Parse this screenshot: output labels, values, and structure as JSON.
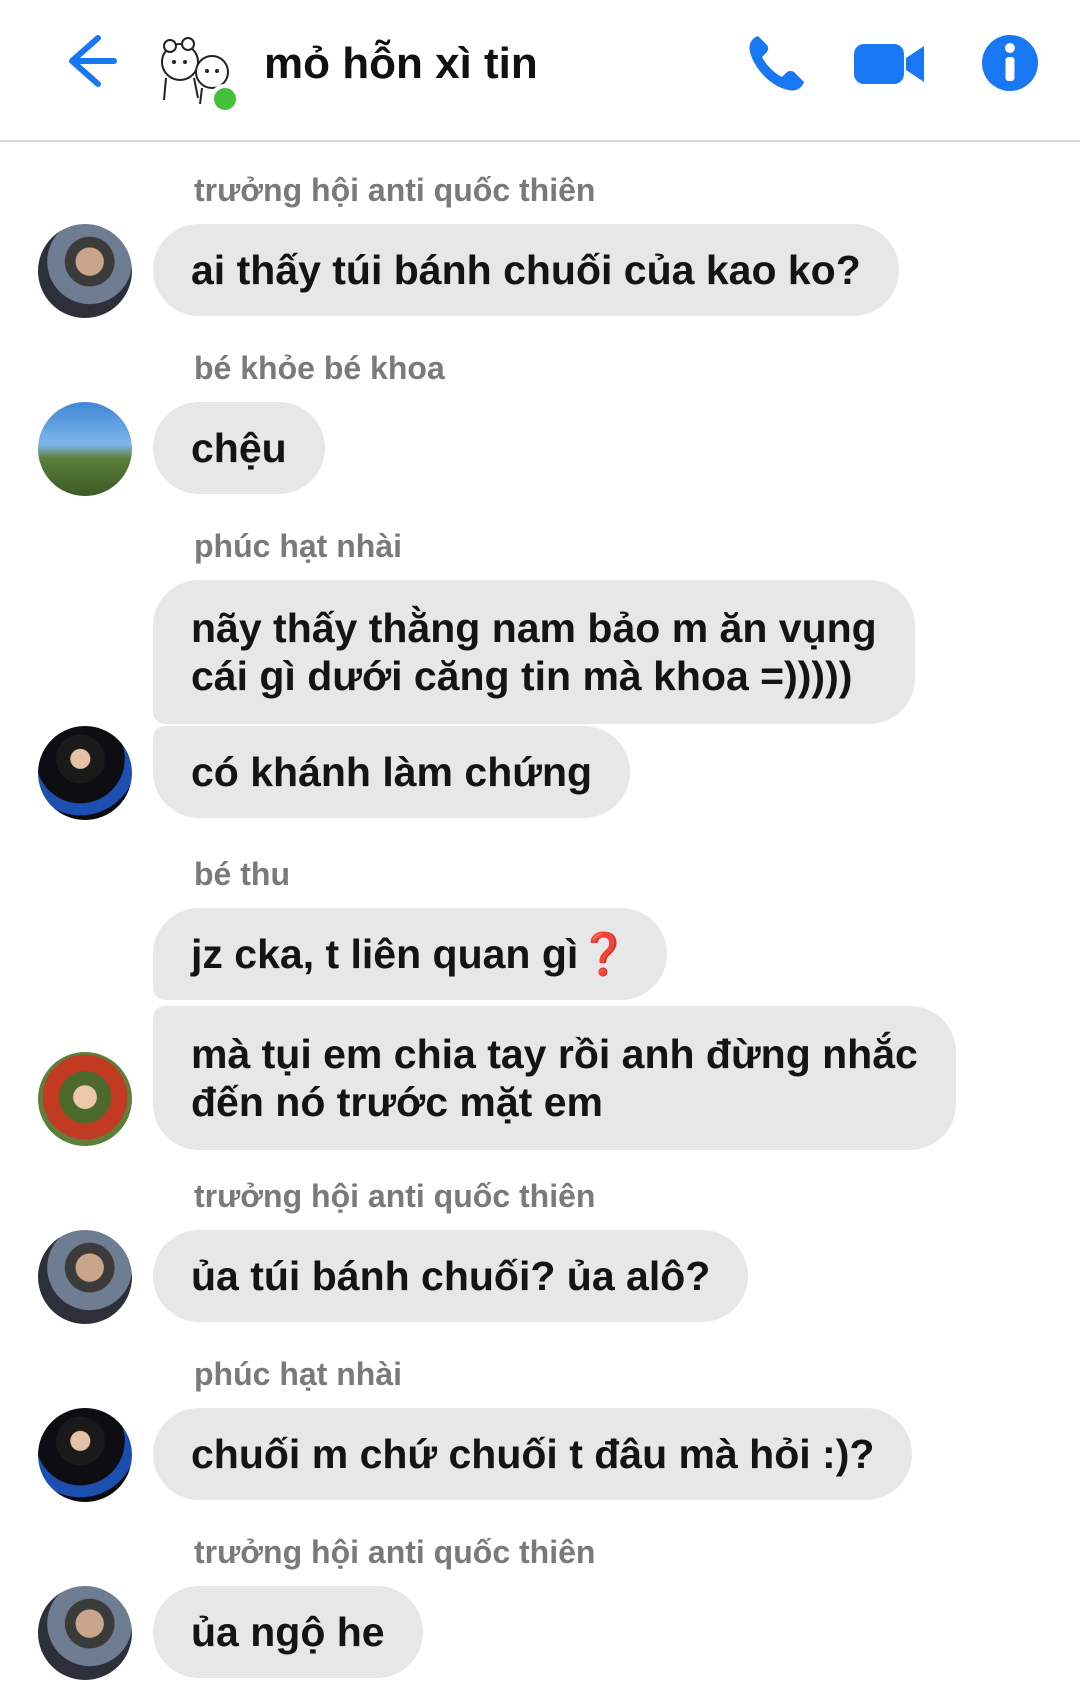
{
  "header": {
    "title": "mỏ hỗn xì tin",
    "accent_color": "#1877f2",
    "online_color": "#44c03b",
    "icons": [
      "back-arrow-icon",
      "group-avatar-icon",
      "phone-icon",
      "video-camera-icon",
      "info-icon"
    ]
  },
  "messages": [
    {
      "sender": "trưởng hội anti quốc thiên",
      "bubbles": [
        "ai thấy túi bánh chuối của kao ko?"
      ]
    },
    {
      "sender": "bé khỏe bé khoa",
      "bubbles": [
        "chệu"
      ]
    },
    {
      "sender": "phúc hạt nhài",
      "bubbles": [
        "nãy thấy thằng nam bảo m ăn vụng\ncái gì dưới căng tin mà khoa =)))))",
        "có khánh làm chứng"
      ]
    },
    {
      "sender": "bé thu",
      "bubbles": [
        "jz cka, t liên quan gì",
        "mà tụi em chia tay rồi anh đừng nhắc\nđến nó trước mặt em"
      ],
      "emoji": "❓"
    },
    {
      "sender": "trưởng hội anti quốc thiên",
      "bubbles": [
        "ủa túi bánh chuối? ủa alô?"
      ]
    },
    {
      "sender": "phúc hạt nhài",
      "bubbles": [
        "chuối m chứ chuối t đâu mà hỏi :)?"
      ]
    },
    {
      "sender": "trưởng hội anti quốc thiên",
      "bubbles": [
        "ủa ngộ he"
      ]
    }
  ]
}
